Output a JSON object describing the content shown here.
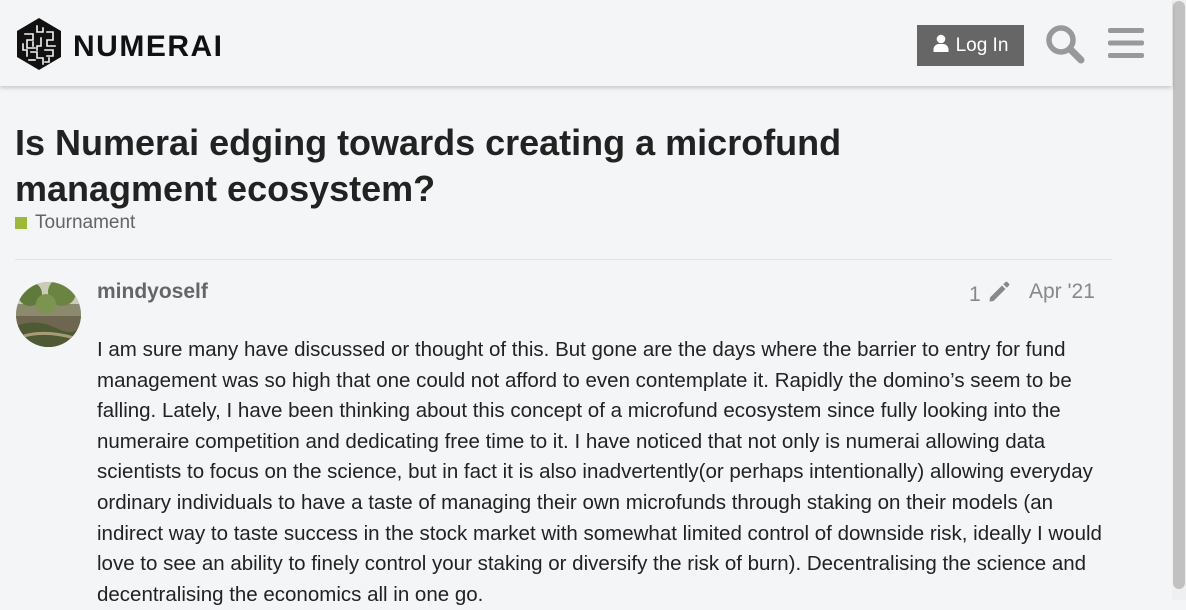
{
  "header": {
    "logo_text": "NUMERAI",
    "login_label": "Log In"
  },
  "topic": {
    "title": "Is Numerai edging towards creating a microfund managment ecosystem?",
    "category": "Tournament",
    "category_color": "#9eb83b"
  },
  "post": {
    "username": "mindyoself",
    "edit_count": "1",
    "date": "Apr '21",
    "body": "I am sure many have discussed or thought of this. But gone are the days where the barrier to entry for fund management was so high that one could not afford to even contemplate it. Rapidly the domino’s seem to be falling. Lately, I have been thinking about this concept of a microfund ecosystem since fully looking into the numeraire competition and dedicating free time to it. I have noticed that not only is numerai allowing data scientists to focus on the science, but in fact it is also inadvertently(or perhaps intentionally) allowing everyday ordinary individuals to have a taste of managing their own microfunds through staking on their models (an indirect way to taste success in the stock market with somewhat limited control of downside risk, ideally I would love to see an ability to finely control your staking or diversify the risk of burn). Decentralising the science and decentralising the economics all in one go."
  },
  "icons": {
    "logo": "numerai-logo-icon",
    "user": "user-icon",
    "search": "search-icon",
    "menu": "hamburger-menu-icon",
    "edit": "pencil-icon"
  }
}
